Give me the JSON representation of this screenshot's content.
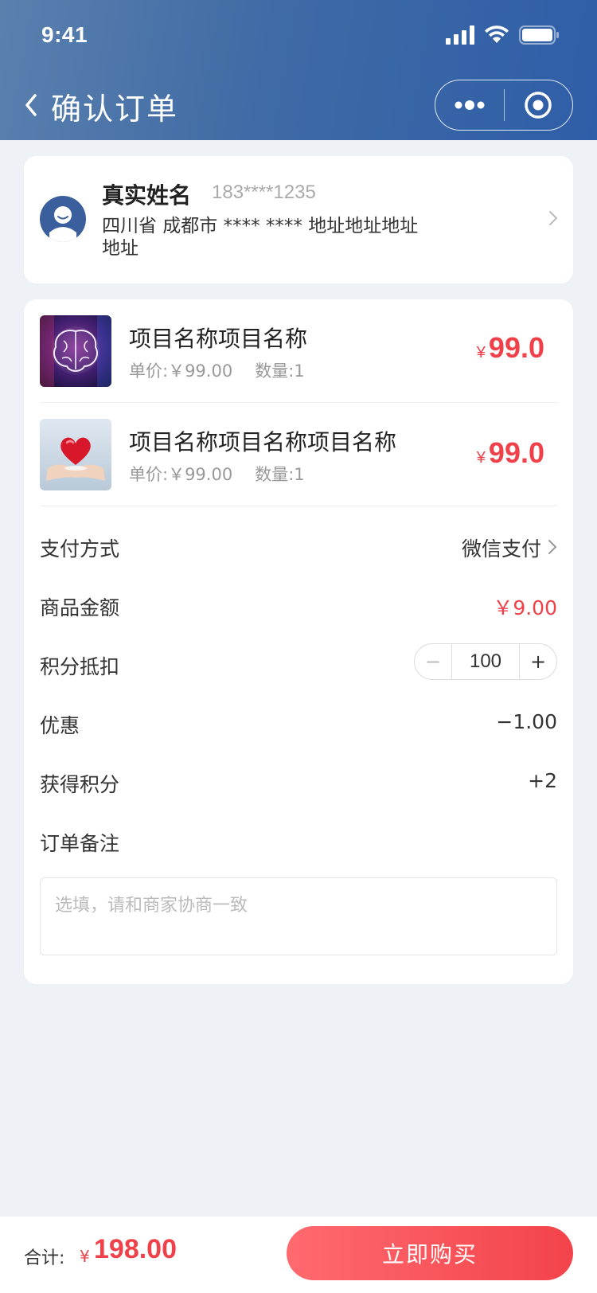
{
  "status": {
    "time": "9:41"
  },
  "nav": {
    "title": "确认订单",
    "back_icon": "chevron-left-icon",
    "more_icon": "more-dots-icon",
    "close_icon": "target-close-icon"
  },
  "address": {
    "name": "真实姓名",
    "phone": "183****1235",
    "detail": "四川省 成都市 **** **** 地址地址地址地址",
    "avatar_icon": "user-avatar-icon"
  },
  "products": [
    {
      "name": "项目名称项目名称",
      "unit_price": "单价:￥99.00",
      "quantity": "数量:1",
      "currency": "¥",
      "price": "99.0",
      "image": "brain-image"
    },
    {
      "name": "项目名称项目名称项目名称",
      "unit_price": "单价:￥99.00",
      "quantity": "数量:1",
      "currency": "¥",
      "price": "99.0",
      "image": "heart-hands-image"
    }
  ],
  "rows": {
    "payment": {
      "label": "支付方式",
      "value": "微信支付"
    },
    "goods_amount": {
      "label": "商品金额",
      "value": "￥9.00"
    },
    "points_deduct": {
      "label": "积分抵扣",
      "minus": "−",
      "value": "100",
      "plus": "+"
    },
    "discount": {
      "label": "优惠",
      "value": "−1.00"
    },
    "earn_points": {
      "label": "获得积分",
      "value": "+2"
    },
    "note": {
      "label": "订单备注",
      "placeholder": "选填，请和商家协商一致"
    }
  },
  "footer": {
    "total_label": "合计:",
    "currency": "¥",
    "total": "198.00",
    "buy_label": "立即购买"
  },
  "colors": {
    "accent_red": "#f0414a",
    "header_blue": "#3f6aa5",
    "bg": "#eef2f7"
  }
}
